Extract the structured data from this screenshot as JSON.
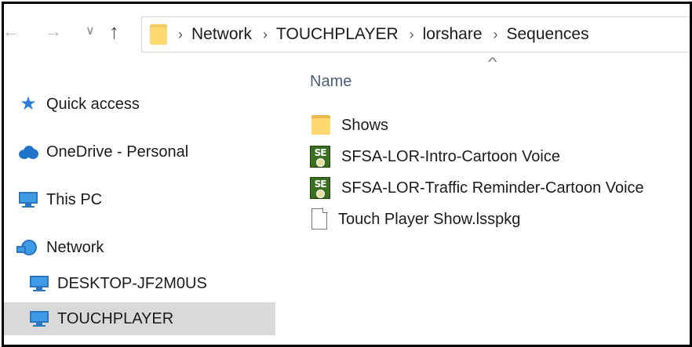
{
  "nav": {
    "back_icon": "left-arrow-icon",
    "forward_icon": "right-arrow-icon",
    "recent_icon": "chevron-down-icon",
    "up_icon": "up-arrow-icon"
  },
  "address": {
    "crumbs": [
      "Network",
      "TOUCHPLAYER",
      "lorshare",
      "Sequences"
    ]
  },
  "sidebar": {
    "items": [
      {
        "label": "Quick access",
        "icon": "star-icon"
      },
      {
        "label": "OneDrive - Personal",
        "icon": "cloud-icon"
      },
      {
        "label": "This PC",
        "icon": "computer-icon"
      },
      {
        "label": "Network",
        "icon": "network-icon"
      },
      {
        "label": "DESKTOP-JF2M0US",
        "icon": "computer-icon"
      },
      {
        "label": "TOUCHPLAYER",
        "icon": "computer-icon",
        "selected": true
      }
    ]
  },
  "filelist": {
    "column_name": "Name",
    "files": [
      {
        "name": "Shows",
        "type": "folder"
      },
      {
        "name": "SFSA-LOR-Intro-Cartoon Voice",
        "type": "sequence"
      },
      {
        "name": "SFSA-LOR-Traffic Reminder-Cartoon Voice",
        "type": "sequence"
      },
      {
        "name": "Touch Player Show.lsspkg",
        "type": "file"
      }
    ]
  },
  "colors": {
    "selection": "#d9d9d9",
    "folder": "#ffd970",
    "icon_blue": "#3d9be8",
    "header_text": "#4c607a"
  }
}
